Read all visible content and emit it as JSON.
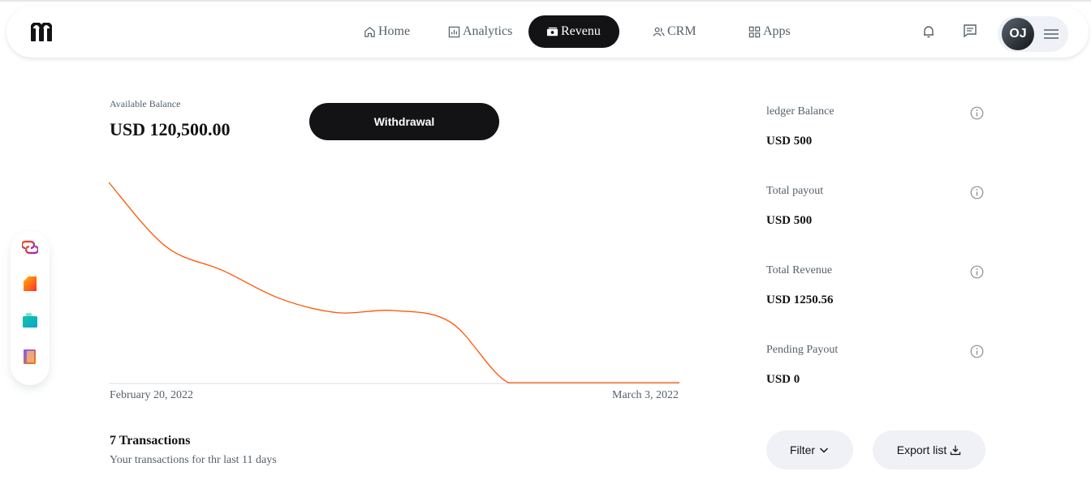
{
  "header": {
    "nav": [
      {
        "label": "Home",
        "icon": "home-icon"
      },
      {
        "label": "Analytics",
        "icon": "analytics-icon"
      },
      {
        "label": "Revenu",
        "icon": "revenue-icon",
        "active": true
      },
      {
        "label": "CRM",
        "icon": "crm-icon"
      },
      {
        "label": "Apps",
        "icon": "apps-icon"
      }
    ],
    "avatar_initials": "OJ"
  },
  "balance": {
    "label": "Available Balance",
    "value": "USD 120,500.00",
    "withdraw_label": "Withdrawal"
  },
  "chart_data": {
    "type": "line",
    "x": [
      "February 20, 2022",
      "March 3, 2022"
    ],
    "x_tick_labels": [
      "February 20, 2022",
      "March 3, 2022"
    ],
    "series": [
      {
        "values": [
          100,
          68,
          56,
          42,
          35,
          36,
          30,
          0,
          0,
          0,
          0
        ],
        "color": "#ff5403"
      }
    ],
    "ylim": [
      0,
      100
    ],
    "grid": false,
    "title": "",
    "xlabel": "",
    "ylabel": ""
  },
  "stats": [
    {
      "label": "ledger Balance",
      "value": "USD 500"
    },
    {
      "label": "Total payout",
      "value": "USD 500"
    },
    {
      "label": "Total Revenue",
      "value": "USD 1250.56"
    },
    {
      "label": "Pending Payout",
      "value": "USD 0"
    }
  ],
  "transactions": {
    "title": "7 Transactions",
    "subtitle": "Your transactions for thr last 11 days",
    "filter_label": "Filter",
    "export_label": "Export list"
  },
  "colors": {
    "primary": "#131316",
    "accent_line": "#ff5403",
    "muted_text": "#56616b",
    "pill_bg": "#eff1f6"
  }
}
